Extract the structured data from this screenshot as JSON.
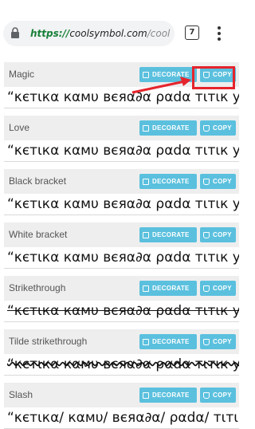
{
  "browser": {
    "url_scheme": "https://",
    "url_host": "coolsymbol.com",
    "url_path": "/cool",
    "tab_count": "7",
    "loading_progress": 0.56
  },
  "colors": {
    "button": "#5bc0de",
    "highlight": "#e5242c",
    "progress": "#37c53a"
  },
  "buttons": {
    "decorate": "DECORATE",
    "copy": "COPY"
  },
  "cards": [
    {
      "title": "Magic",
      "text": "“κєтιкα кαмυ вєяα∂α ραdα тιтιк у"
    },
    {
      "title": "Love",
      "text": "“κєтιкα кαмυ вєяα∂α ραdα тιтιк у"
    },
    {
      "title": "Black bracket",
      "text": "“κєтιкα кαмυ вєяα∂α ραdα тιтιк у"
    },
    {
      "title": "White bracket",
      "text": "“κєтιкα кαмυ вєяα∂α ραdα тιтιк у"
    },
    {
      "title": "Strikethrough",
      "text": "“κєтιкα кαмυ вєяα∂α ραdα тιтιк у"
    },
    {
      "title": "Tilde strikethrough",
      "text": "“κєтιкα кαмυ вєяα∂α ραdα тιтιк у"
    },
    {
      "title": "Slash",
      "text": "“κєтιкα/ кαмυ/ вєяα∂α/ ραdα/ тιтιк/"
    }
  ]
}
